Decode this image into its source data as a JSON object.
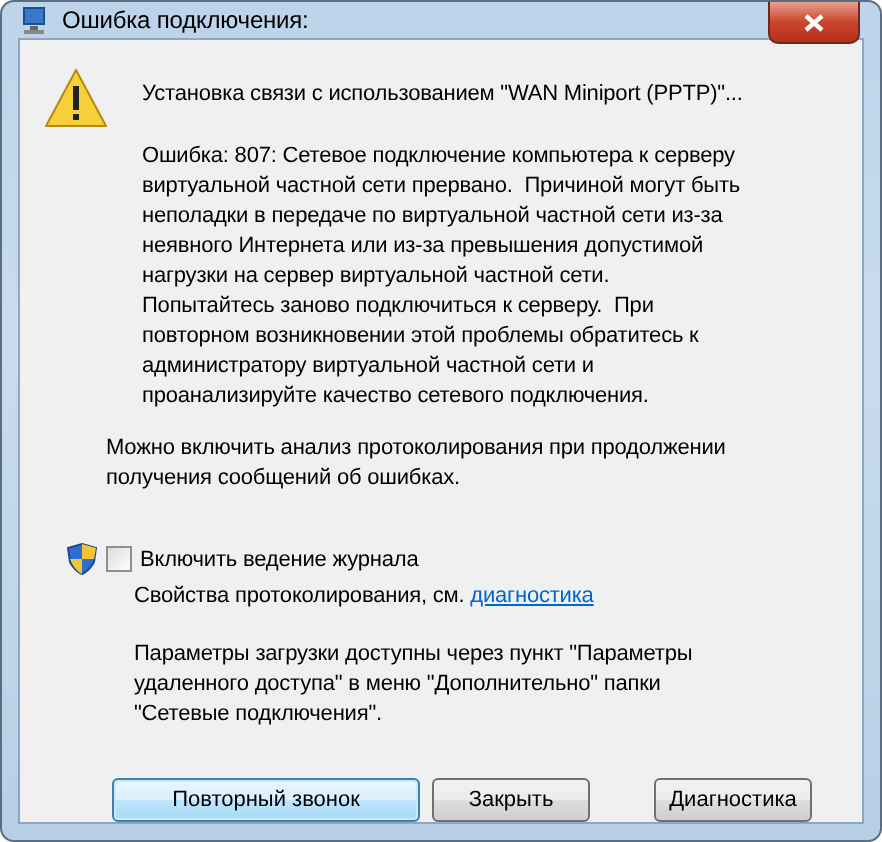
{
  "window": {
    "title": "Ошибка подключения:"
  },
  "message": "Установка связи с использованием \"WAN Miniport (PPTP)\"...",
  "error_text": "Ошибка: 807: Сетевое подключение компьютера к серверу виртуальной частной сети прервано.  Причиной могут быть неполадки в передаче по виртуальной частной сети из-за неявного Интернета или из-за превышения допустимой нагрузки на сервер виртуальной частной сети.  Попытайтесь заново подключиться к серверу.  При повторном возникновении этой проблемы обратитесь к администратору виртуальной частной сети и проанализируйте качество сетевого подключения.",
  "logging_note": "Можно включить анализ протоколирования при продолжении получения сообщений об ошибках.",
  "logging_checkbox": {
    "label": "Включить ведение журнала",
    "checked": false
  },
  "properties": {
    "text": "Свойства протоколирования, см.",
    "link": "диагностика"
  },
  "load_note": "Параметры загрузки доступны через пункт \"Параметры удаленного доступа\" в меню \"Дополнительно\" папки \"Сетевые подключения\".",
  "buttons": [
    {
      "label": "Повторный звонок",
      "default": true
    },
    {
      "label": "Закрыть",
      "default": false
    },
    {
      "label": "Диагностика",
      "default": false
    }
  ]
}
